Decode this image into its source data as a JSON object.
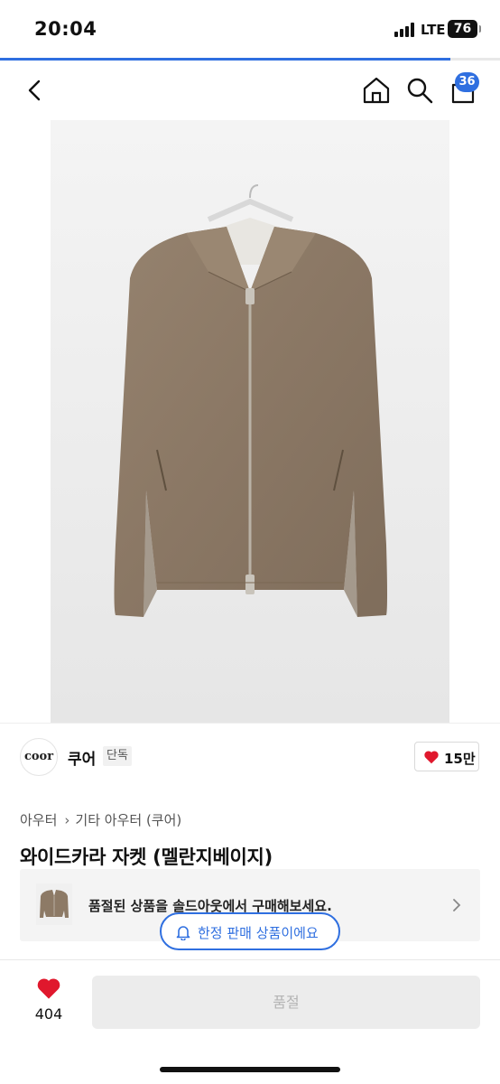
{
  "status_bar": {
    "time": "20:04",
    "network": "LTE",
    "battery": "76"
  },
  "page_progress": 0.9,
  "nav": {
    "cart_count": "36"
  },
  "brand": {
    "logo_text": "coor",
    "name": "쿠어",
    "badge": "단독",
    "likes": "15만"
  },
  "breadcrumb": [
    "아우터",
    "기타 아우터 (쿠어)"
  ],
  "product": {
    "title": "와이드카라 자켓 (멜란지베이지)"
  },
  "soldout_banner": {
    "message": "품절된 상품을 솔드아웃에서 구매해보세요."
  },
  "limited_pill": {
    "label": "한정 판매 상품이에요"
  },
  "bottom_bar": {
    "wish_count": "404",
    "buy_label": "품절"
  },
  "colors": {
    "accent": "#2f6fe0",
    "heart": "#e0182d",
    "jacket": "#8d7a66"
  }
}
